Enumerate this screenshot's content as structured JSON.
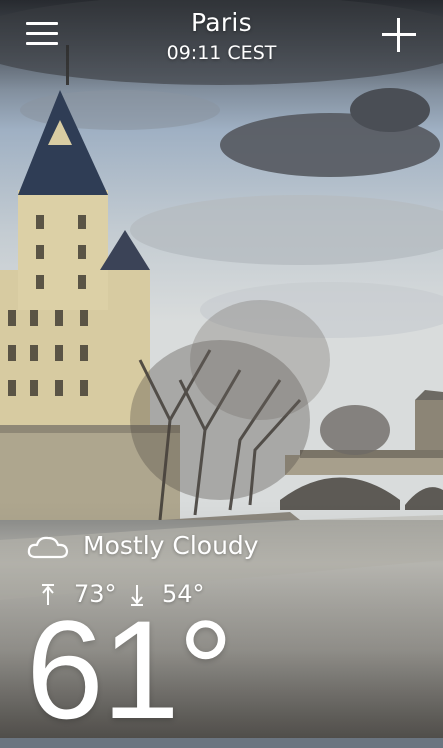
{
  "header": {
    "city": "Paris",
    "time": "09:11 CEST",
    "menu_icon": "hamburger-menu-icon",
    "add_icon": "plus-icon"
  },
  "weather": {
    "condition_icon": "cloud-icon",
    "condition": "Mostly Cloudy",
    "high": "73°",
    "low": "54°",
    "current_temp": "61°"
  },
  "colors": {
    "text": "#ffffff",
    "sky": "#a9b7c6",
    "storm_cloud": "#4a4f57",
    "water": "#c9c7c1",
    "stone": "#d8cb9e"
  }
}
